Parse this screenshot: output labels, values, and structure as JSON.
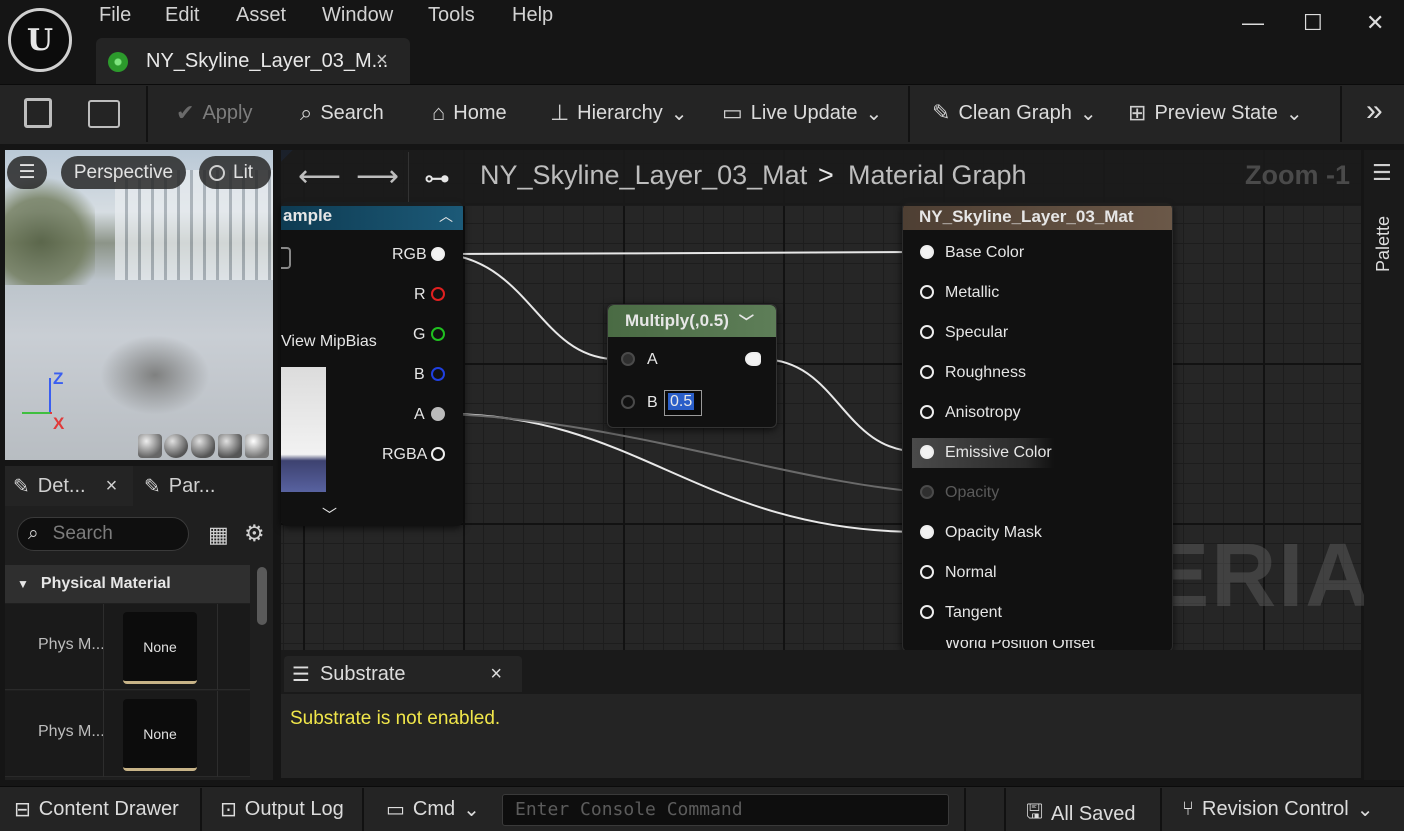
{
  "menu": [
    "File",
    "Edit",
    "Asset",
    "Window",
    "Tools",
    "Help"
  ],
  "logo_glyph": "U",
  "doc_tab": {
    "title": "NY_Skyline_Layer_03_M...",
    "close": "×"
  },
  "window_controls": {
    "minimize": "—",
    "maximize": "☐",
    "close": "✕"
  },
  "toolbar": {
    "apply": "Apply",
    "search": "Search",
    "home": "Home",
    "hierarchy": "Hierarchy",
    "live_update": "Live Update",
    "clean_graph": "Clean Graph",
    "preview_state": "Preview State",
    "chevron": "⌄",
    "more": "»"
  },
  "viewport": {
    "perspective": "Perspective",
    "lit": "Lit",
    "axis_z": "Z",
    "axis_x": "X"
  },
  "panel_tabs": {
    "details": "Det...",
    "parameters": "Par...",
    "close": "×"
  },
  "details": {
    "search_placeholder": "Search",
    "category": "Physical Material",
    "rows": [
      {
        "label": "Phys M...",
        "value": "None"
      },
      {
        "label": "Phys M...",
        "value": "None"
      }
    ]
  },
  "graph": {
    "breadcrumb_asset": "NY_Skyline_Layer_03_Mat",
    "breadcrumb_sep": ">",
    "breadcrumb_graph": "Material Graph",
    "zoom": "Zoom -1",
    "watermark": "MATERIAL",
    "texture_node": {
      "title": "ample",
      "input_label": "View MipBias",
      "outputs": [
        "RGB",
        "R",
        "G",
        "B",
        "A",
        "RGBA"
      ],
      "output_colors": [
        "#eeeeee",
        "#e02020",
        "#20c020",
        "#2040e0",
        "#cccccc",
        "#eeeeee"
      ]
    },
    "multiply_node": {
      "title": "Multiply(,0.5)",
      "input_a": "A",
      "input_b": "B",
      "b_value": "0.5"
    },
    "result_node": {
      "title": "NY_Skyline_Layer_03_Mat",
      "inputs": [
        "Base Color",
        "Metallic",
        "Specular",
        "Roughness",
        "Anisotropy",
        "Emissive Color",
        "Opacity",
        "Opacity Mask",
        "Normal",
        "Tangent",
        "World Position Offset"
      ]
    }
  },
  "palette_label": "Palette",
  "substrate": {
    "tab": "Substrate",
    "close": "×",
    "message": "Substrate is not enabled."
  },
  "statusbar": {
    "content_drawer": "Content Drawer",
    "output_log": "Output Log",
    "cmd": "Cmd",
    "console_placeholder": "Enter Console Command",
    "all_saved": "All Saved",
    "revision_control": "Revision Control"
  }
}
